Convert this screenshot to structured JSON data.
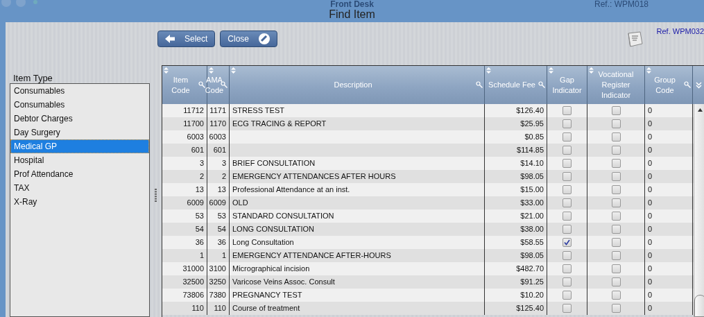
{
  "window": {
    "app_title": "Front Desk",
    "title": "Find Item",
    "app_ref": "Ref.: WPM018"
  },
  "toolbar": {
    "buttons": [
      {
        "label": "Select",
        "kind": "select"
      },
      {
        "label": "Close",
        "kind": "close"
      }
    ],
    "ref": "Ref. WPM032"
  },
  "item_type": {
    "label": "Item Type",
    "items": [
      {
        "label": "Consumables",
        "selected": false
      },
      {
        "label": "Consumables",
        "selected": false
      },
      {
        "label": "Debtor Charges",
        "selected": false
      },
      {
        "label": "Day Surgery",
        "selected": false
      },
      {
        "label": "Medical GP",
        "selected": true
      },
      {
        "label": "Hospital",
        "selected": false
      },
      {
        "label": "Prof Attendance",
        "selected": false
      },
      {
        "label": "TAX",
        "selected": false
      },
      {
        "label": "X-Ray",
        "selected": false
      }
    ]
  },
  "table": {
    "columns": [
      {
        "label": "Item Code",
        "searchable": true
      },
      {
        "label": "AMA Code",
        "searchable": true
      },
      {
        "label": "Description",
        "searchable": true
      },
      {
        "label": "Schedule Fee",
        "searchable": true
      },
      {
        "label": "Gap Indicator",
        "searchable": false
      },
      {
        "label": "Vocational Register Indicator",
        "searchable": false
      },
      {
        "label": "Group Code",
        "searchable": true
      }
    ],
    "rows": [
      {
        "item_code": "11712",
        "ama_code": "1171",
        "description": "STRESS TEST",
        "fee": "$126.40",
        "gap": false,
        "vocational": false,
        "group": "0"
      },
      {
        "item_code": "11700",
        "ama_code": "1170",
        "description": "ECG TRACING & REPORT",
        "fee": "$25.95",
        "gap": false,
        "vocational": false,
        "group": "0"
      },
      {
        "item_code": "6003",
        "ama_code": "6003",
        "description": "",
        "fee": "$0.85",
        "gap": false,
        "vocational": false,
        "group": "0"
      },
      {
        "item_code": "601",
        "ama_code": "601",
        "description": "",
        "fee": "$114.85",
        "gap": false,
        "vocational": false,
        "group": "0"
      },
      {
        "item_code": "3",
        "ama_code": "3",
        "description": "BRIEF CONSULTATION",
        "fee": "$14.10",
        "gap": false,
        "vocational": false,
        "group": "0"
      },
      {
        "item_code": "2",
        "ama_code": "2",
        "description": "EMERGENCY ATTENDANCES AFTER HOURS",
        "fee": "$98.05",
        "gap": false,
        "vocational": false,
        "group": "0"
      },
      {
        "item_code": "13",
        "ama_code": "13",
        "description": "Professional Attendance at an inst.",
        "fee": "$15.00",
        "gap": false,
        "vocational": false,
        "group": "0"
      },
      {
        "item_code": "6009",
        "ama_code": "6009",
        "description": "OLD",
        "fee": "$33.00",
        "gap": false,
        "vocational": false,
        "group": "0"
      },
      {
        "item_code": "53",
        "ama_code": "53",
        "description": "STANDARD CONSULTATION",
        "fee": "$21.00",
        "gap": false,
        "vocational": false,
        "group": "0"
      },
      {
        "item_code": "54",
        "ama_code": "54",
        "description": "LONG CONSULTATION",
        "fee": "$38.00",
        "gap": false,
        "vocational": false,
        "group": "0"
      },
      {
        "item_code": "36",
        "ama_code": "36",
        "description": "Long Consultation",
        "fee": "$58.55",
        "gap": true,
        "vocational": false,
        "group": "0"
      },
      {
        "item_code": "1",
        "ama_code": "1",
        "description": "EMERGENCY ATTENDANCE AFTER-HOURS",
        "fee": "$98.05",
        "gap": false,
        "vocational": false,
        "group": "0"
      },
      {
        "item_code": "31000",
        "ama_code": "3100",
        "description": "Micrographical incision",
        "fee": "$482.70",
        "gap": false,
        "vocational": false,
        "group": "0"
      },
      {
        "item_code": "32500",
        "ama_code": "3250",
        "description": "Varicose Veins Assoc. Consult",
        "fee": "$91.25",
        "gap": false,
        "vocational": false,
        "group": "0"
      },
      {
        "item_code": "73806",
        "ama_code": "7380",
        "description": "PREGNANCY TEST",
        "fee": "$10.20",
        "gap": false,
        "vocational": false,
        "group": "0"
      },
      {
        "item_code": "110",
        "ama_code": "110",
        "description": "Course of treatment",
        "fee": "$125.40",
        "gap": false,
        "vocational": false,
        "group": "0"
      }
    ]
  }
}
